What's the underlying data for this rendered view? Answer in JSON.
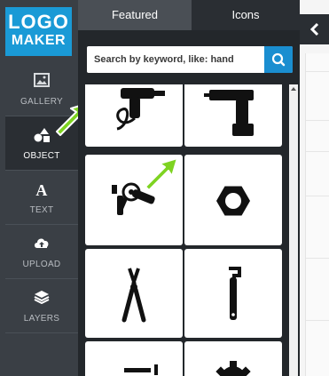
{
  "logo": {
    "line1": "LOGO",
    "line2": "MAKER",
    "color": "#1a9ad6"
  },
  "sidebar": {
    "items": [
      {
        "label": "GALLERY",
        "icon": "image-icon"
      },
      {
        "label": "OBJECT",
        "icon": "shapes-icon",
        "active": true
      },
      {
        "label": "TEXT",
        "icon": "text-a-icon"
      },
      {
        "label": "UPLOAD",
        "icon": "cloud-upload-icon"
      },
      {
        "label": "LAYERS",
        "icon": "layers-icon"
      }
    ]
  },
  "tabs": [
    {
      "label": "Featured",
      "active": false
    },
    {
      "label": "Icons",
      "active": true
    }
  ],
  "search": {
    "placeholder": "Search by keyword, like: hand",
    "value": ""
  },
  "grid": {
    "icons": [
      "power-drill-icon",
      "cordless-drill-icon",
      "angle-grinder-icon",
      "hex-nut-icon",
      "wire-cutter-icon",
      "pipe-wrench-icon",
      "tool-icon",
      "gear-icon"
    ]
  },
  "colors": {
    "accent": "#1a8ed0",
    "highlight_arrow": "#7ed321",
    "sidebar_bg": "#3a3f45"
  }
}
